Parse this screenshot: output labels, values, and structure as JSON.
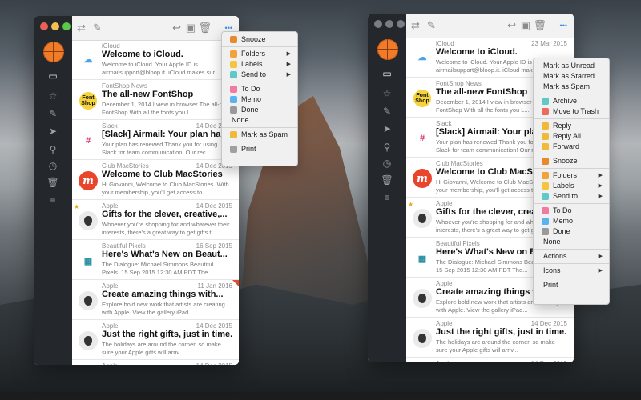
{
  "colors": {
    "accent": "#f07c2a",
    "sidebar": "#24272b",
    "red": "#ec5f57",
    "yellow": "#f5bf4f",
    "green": "#5cc748"
  },
  "left_window": {
    "emails": [
      {
        "sender": "iCloud",
        "date": "",
        "subject": "Welcome to iCloud.",
        "preview": "Welcome to iCloud. Your Apple ID is airmailsupport@bloop.it. iCloud makes sur...",
        "icon": "cloud-icon"
      },
      {
        "sender": "FontShop News",
        "date": "",
        "subject": "The all-new FontShop",
        "preview": "December 1, 2014 I view in browser The all-new FontShop With all the fonts you L...",
        "icon": "fontshop-icon",
        "logo_text": "Font Shop"
      },
      {
        "sender": "Slack",
        "date": "14 Dec 2015",
        "subject": "[Slack] Airmail: Your plan has",
        "preview": "Your plan has renewed Thank you for using Slack for team communication! Our rec...",
        "icon": "slack-icon"
      },
      {
        "sender": "Club MacStories",
        "date": "14 Dec 2015",
        "subject": "Welcome to Club MacStories",
        "preview": "Hi Giovanni, Welcome to Club MacStories. With your membership, you'll get access to...",
        "icon": "macstories-icon",
        "logo_text": "m"
      },
      {
        "sender": "Apple",
        "date": "14 Dec 2015",
        "subject": "Gifts for the clever, creative,...",
        "preview": "Whoever you're shopping for and whatever their interests, there's a great way to get gifts t...",
        "icon": "apple-icon",
        "starred": true
      },
      {
        "sender": "Beautiful Pixels",
        "date": "16 Sep 2015",
        "subject": "Here's What's New on Beaut...",
        "preview": "The Dialogue: Michael Simmons Beautiful Pixels. 15 Sep 2015 12:30 AM PDT The...",
        "icon": "pixels-icon"
      },
      {
        "sender": "Apple",
        "date": "11 Jan 2016",
        "subject": "Create amazing things with...",
        "preview": "Explore bold new work that artists are creating with Apple. View the gallery iPad...",
        "icon": "apple-icon",
        "flagged": true
      },
      {
        "sender": "Apple",
        "date": "14 Dec 2015",
        "subject": "Just the right gifts, just in time.",
        "preview": "The holidays are around the corner, so make sure your Apple gifts will arriv...",
        "icon": "apple-icon"
      },
      {
        "sender": "Apple",
        "date": "14 Dec 2015",
        "subject": "",
        "preview": "",
        "icon": "apple-icon"
      }
    ],
    "menu": [
      {
        "label": "Snooze",
        "icon": "snooze-icon",
        "color": "#e8892e"
      },
      {
        "sep": true
      },
      {
        "label": "Folders",
        "icon": "folders-icon",
        "color": "#f2a23a",
        "arrow": "▶"
      },
      {
        "label": "Labels",
        "icon": "labels-icon",
        "color": "#f5c542",
        "arrow": "▶"
      },
      {
        "label": "Send to",
        "icon": "sendto-icon",
        "color": "#5fc9c7",
        "arrow": "▶"
      },
      {
        "sep": true
      },
      {
        "label": "To Do",
        "icon": "todo-icon",
        "color": "#f07aa0"
      },
      {
        "label": "Memo",
        "icon": "memo-icon",
        "color": "#5ab3f0"
      },
      {
        "label": "Done",
        "icon": "done-icon",
        "color": "#9a9a9a"
      },
      {
        "label": "None",
        "icon": "",
        "color": ""
      },
      {
        "sep": true
      },
      {
        "label": "Mark as Spam",
        "icon": "spam-icon",
        "color": "#f0b93a"
      },
      {
        "sep": true
      },
      {
        "label": "Print",
        "icon": "print-icon",
        "color": "#a0a0a0"
      }
    ]
  },
  "right_window": {
    "emails": [
      {
        "sender": "iCloud",
        "date": "23 Mar 2015",
        "subject": "Welcome to iCloud.",
        "preview": "Welcome to iCloud. Your Apple ID is airmailsupport@bloop.it. iCloud makes sur...",
        "icon": "cloud-icon"
      },
      {
        "sender": "FontShop News",
        "date": "",
        "subject": "The all-new FontShop",
        "preview": "December 1, 2014 I view in browser The all-new FontShop With all the fonts you L...",
        "icon": "fontshop-icon",
        "logo_text": "Font Shop"
      },
      {
        "sender": "Slack",
        "date": "",
        "subject": "[Slack] Airmail: Your plan has",
        "preview": "Your plan has renewed Thank you for using Slack for team communication! Our rec...",
        "icon": "slack-icon"
      },
      {
        "sender": "Club MacStories",
        "date": "",
        "subject": "Welcome to Club MacStories",
        "preview": "Hi Giovanni, Welcome to Club MacStories. With your membership, you'll get access to...",
        "icon": "macstories-icon",
        "logo_text": "m"
      },
      {
        "sender": "Apple",
        "date": "",
        "subject": "Gifts for the clever, creative,...",
        "preview": "Whoever you're shopping for and whatever their interests, there's a great way to get gifts t...",
        "icon": "apple-icon",
        "starred": true
      },
      {
        "sender": "Beautiful Pixels",
        "date": "",
        "subject": "Here's What's New on Beaut...",
        "preview": "The Dialogue: Michael Simmons Beautiful Pixels. 15 Sep 2015 12:30 AM PDT The...",
        "icon": "pixels-icon"
      },
      {
        "sender": "Apple",
        "date": "",
        "subject": "Create amazing things with...",
        "preview": "Explore bold new work that artists are creating with Apple. View the gallery iPad...",
        "icon": "apple-icon"
      },
      {
        "sender": "Apple",
        "date": "14 Dec 2015",
        "subject": "Just the right gifts, just in time.",
        "preview": "The holidays are around the corner, so make sure your Apple gifts will arriv...",
        "icon": "apple-icon"
      },
      {
        "sender": "Apple",
        "date": "14 Dec 2015",
        "subject": "",
        "preview": "",
        "icon": "apple-icon"
      }
    ],
    "menu": [
      {
        "label": "Mark as Unread",
        "icon": "",
        "color": ""
      },
      {
        "label": "Mark as Starred",
        "icon": "",
        "color": ""
      },
      {
        "label": "Mark as Spam",
        "icon": "",
        "color": ""
      },
      {
        "sep": true
      },
      {
        "label": "Archive",
        "icon": "archive-icon",
        "color": "#5fc9c7"
      },
      {
        "label": "Move to Trash",
        "icon": "trash-icon",
        "color": "#ec6b5e"
      },
      {
        "sep": true
      },
      {
        "label": "Reply",
        "icon": "reply-icon",
        "color": "#f0b93a"
      },
      {
        "label": "Reply All",
        "icon": "reply-all-icon",
        "color": "#f0b93a"
      },
      {
        "label": "Forward",
        "icon": "forward-icon",
        "color": "#f0b93a"
      },
      {
        "sep": true
      },
      {
        "label": "Snooze",
        "icon": "snooze-icon",
        "color": "#e8892e"
      },
      {
        "sep": true
      },
      {
        "label": "Folders",
        "icon": "folders-icon",
        "color": "#f2a23a",
        "arrow": "▶"
      },
      {
        "label": "Labels",
        "icon": "labels-icon",
        "color": "#f5c542",
        "arrow": "▶"
      },
      {
        "label": "Send to",
        "icon": "sendto-icon",
        "color": "#5fc9c7",
        "arrow": "▶"
      },
      {
        "sep": true
      },
      {
        "label": "To Do",
        "icon": "todo-icon",
        "color": "#f07aa0"
      },
      {
        "label": "Memo",
        "icon": "memo-icon",
        "color": "#5ab3f0"
      },
      {
        "label": "Done",
        "icon": "done-icon",
        "color": "#9a9a9a"
      },
      {
        "label": "None",
        "icon": "",
        "color": ""
      },
      {
        "sep": true
      },
      {
        "label": "Actions",
        "icon": "",
        "color": "",
        "arrow": "▶"
      },
      {
        "sep": true
      },
      {
        "label": "Icons",
        "icon": "",
        "color": "",
        "arrow": "▶"
      },
      {
        "sep": true
      },
      {
        "label": "Print",
        "icon": "",
        "color": ""
      }
    ]
  },
  "sidebar_icons": [
    "inbox-icon",
    "star-icon",
    "pencil-icon",
    "send-icon",
    "search-icon",
    "alarm-icon",
    "trash-icon",
    "menu-icon"
  ],
  "toolbar_icons": [
    "refresh-icon",
    "compose-icon",
    "reply-icon",
    "archive-icon",
    "trash-icon",
    "more-icon"
  ]
}
